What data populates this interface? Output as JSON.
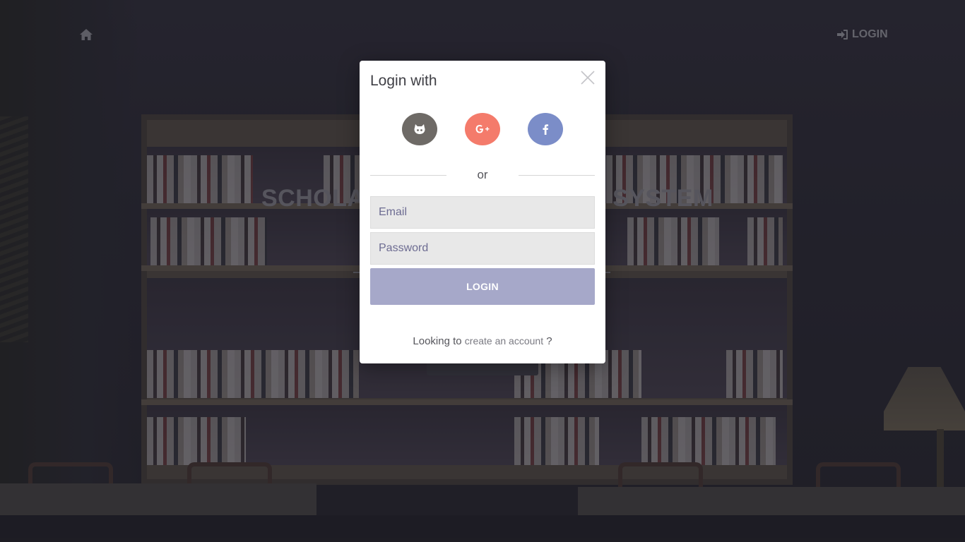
{
  "header": {
    "home_icon": "home-icon",
    "login_icon": "sign-in-icon",
    "login_label": "LOGIN"
  },
  "hero": {
    "title_left": "SCHOLA",
    "title_right": "SYSTEM"
  },
  "modal": {
    "title": "Login with",
    "close_icon": "close-icon",
    "social": [
      {
        "name": "github",
        "icon": "github-icon",
        "color": "#6e6a66"
      },
      {
        "name": "google-plus",
        "icon": "google-plus-icon",
        "color": "#f47b6b"
      },
      {
        "name": "facebook",
        "icon": "facebook-icon",
        "color": "#7b8dc8"
      }
    ],
    "divider_text": "or",
    "email_placeholder": "Email",
    "password_placeholder": "Password",
    "login_button": "LOGIN",
    "footer_prefix": "Looking to",
    "footer_link": "create an account",
    "footer_suffix": "?"
  },
  "colors": {
    "login_button": "#a6a8c9",
    "input_bg": "#e8e8e8",
    "placeholder": "#6d6c92"
  }
}
